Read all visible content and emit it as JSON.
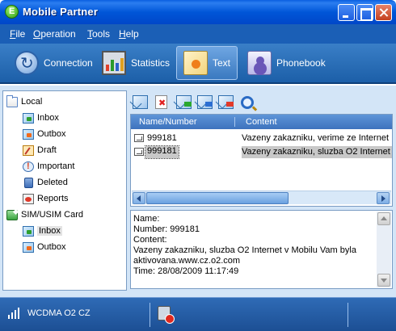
{
  "window": {
    "title": "Mobile Partner"
  },
  "menu": [
    {
      "label": "File",
      "key": "F",
      "rest": "ile"
    },
    {
      "label": "Operation",
      "key": "O",
      "rest": "peration"
    },
    {
      "label": "Tools",
      "key": "T",
      "rest": "ools"
    },
    {
      "label": "Help",
      "key": "H",
      "rest": "elp"
    }
  ],
  "nav": {
    "connection": "Connection",
    "statistics": "Statistics",
    "text": "Text",
    "phonebook": "Phonebook",
    "active": "Text"
  },
  "tree": {
    "local": {
      "label": "Local",
      "items": [
        "Inbox",
        "Outbox",
        "Draft",
        "Important",
        "Deleted",
        "Reports"
      ]
    },
    "sim": {
      "label": "SIM/USIM Card",
      "items": [
        "Inbox",
        "Outbox"
      ],
      "selected": "Inbox"
    }
  },
  "toolbar": {
    "icons": [
      "new-message-icon",
      "delete-icon",
      "reply-icon",
      "forward-icon",
      "export-icon",
      "search-icon"
    ]
  },
  "list": {
    "columns": [
      "Name/Number",
      "Content"
    ],
    "rows": [
      {
        "number": "999181",
        "content": "Vazeny zakazniku, verime ze Internet"
      },
      {
        "number": "999181",
        "content": "Vazeny zakazniku, sluzba O2 Internet"
      }
    ],
    "selected_index": 1
  },
  "detail": {
    "name_line": "Name:",
    "number_line": "Number: 999181",
    "content_label": "Content:",
    "content_line1": "Vazeny zakazniku, sluzba O2 Internet v Mobilu Vam byla",
    "content_line2": "aktivovana.www.cz.o2.com",
    "time_line": "Time: 28/08/2009 11:17:49"
  },
  "status": {
    "network": "WCDMA  O2 CZ"
  }
}
